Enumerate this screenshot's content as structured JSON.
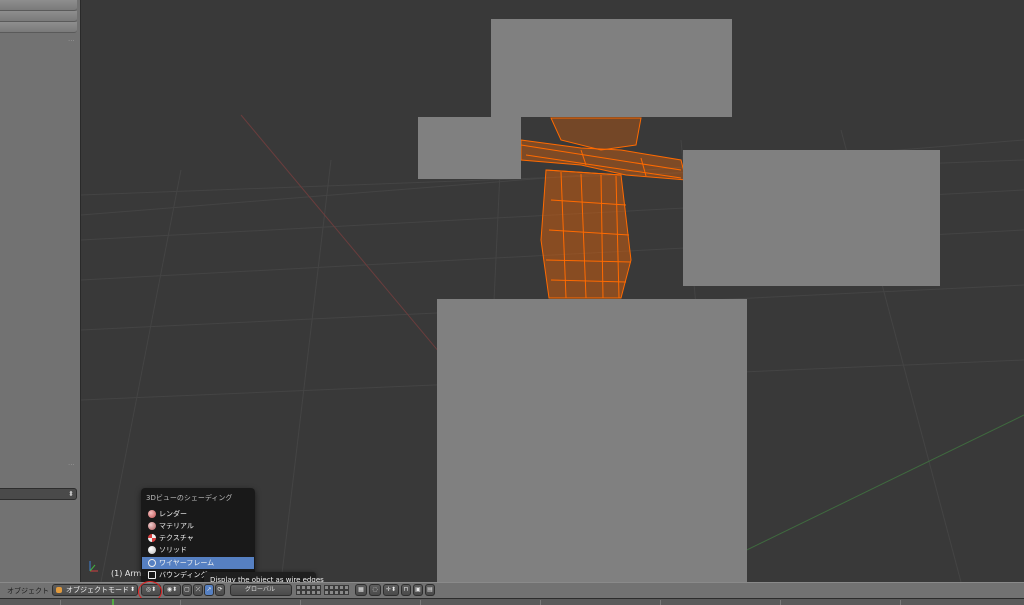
{
  "viewport": {
    "object_info": "(1) Armat"
  },
  "shading_popup": {
    "title": "3Dビューのシェーディング",
    "items": [
      {
        "label": "レンダー",
        "icon": "render-sphere-icon",
        "color": "#c05050"
      },
      {
        "label": "マテリアル",
        "icon": "material-sphere-icon",
        "color": "#c06a6a"
      },
      {
        "label": "テクスチャ",
        "icon": "texture-checker-icon",
        "color": "#d84040"
      },
      {
        "label": "ソリッド",
        "icon": "solid-sphere-icon",
        "color": "#f0f0f0"
      },
      {
        "label": "ワイヤーフレーム",
        "icon": "wireframe-sphere-icon",
        "color": "#e8e8e8",
        "active": true
      },
      {
        "label": "バウンディング",
        "icon": "bounding-box-icon",
        "color": "#e8e8e8"
      }
    ]
  },
  "tooltip": {
    "text": "Display the object as wire edges"
  },
  "header": {
    "menu_label": "オブジェクト",
    "mode": "オブジェクトモード",
    "pivot": "グローバル"
  },
  "colors": {
    "viewport_bg": "#393939",
    "wire": "#ff6a00",
    "highlight": "#5680c2",
    "annotation_circle": "#e02020"
  }
}
